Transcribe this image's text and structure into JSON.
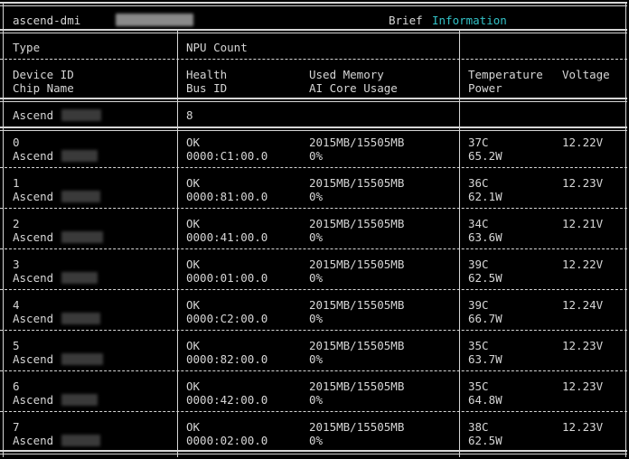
{
  "header": {
    "title": "ascend-dmi",
    "brief": "Brief",
    "information": "Information"
  },
  "summary_header": {
    "type": "Type",
    "npu_count": "NPU Count"
  },
  "column_header": {
    "device_id": "Device ID",
    "chip_name": "Chip Name",
    "health": "Health",
    "bus_id": "Bus ID",
    "used_memory": "Used Memory",
    "ai_core_usage": "AI Core Usage",
    "temperature": "Temperature",
    "power": "Power",
    "voltage": "Voltage"
  },
  "summary": {
    "type": "Ascend",
    "npu_count": "8"
  },
  "devices": [
    {
      "id": "0",
      "chip": "Ascend",
      "health": "OK",
      "bus": "0000:C1:00.0",
      "mem": "2015MB/15505MB",
      "core": "0%",
      "temp": "37C",
      "power": "65.2W",
      "volt": "12.22V"
    },
    {
      "id": "1",
      "chip": "Ascend",
      "health": "OK",
      "bus": "0000:81:00.0",
      "mem": "2015MB/15505MB",
      "core": "0%",
      "temp": "36C",
      "power": "62.1W",
      "volt": "12.23V"
    },
    {
      "id": "2",
      "chip": "Ascend",
      "health": "OK",
      "bus": "0000:41:00.0",
      "mem": "2015MB/15505MB",
      "core": "0%",
      "temp": "34C",
      "power": "63.6W",
      "volt": "12.21V"
    },
    {
      "id": "3",
      "chip": "Ascend",
      "health": "OK",
      "bus": "0000:01:00.0",
      "mem": "2015MB/15505MB",
      "core": "0%",
      "temp": "39C",
      "power": "62.5W",
      "volt": "12.22V"
    },
    {
      "id": "4",
      "chip": "Ascend",
      "health": "OK",
      "bus": "0000:C2:00.0",
      "mem": "2015MB/15505MB",
      "core": "0%",
      "temp": "39C",
      "power": "66.7W",
      "volt": "12.24V"
    },
    {
      "id": "5",
      "chip": "Ascend",
      "health": "OK",
      "bus": "0000:82:00.0",
      "mem": "2015MB/15505MB",
      "core": "0%",
      "temp": "35C",
      "power": "63.7W",
      "volt": "12.23V"
    },
    {
      "id": "6",
      "chip": "Ascend",
      "health": "OK",
      "bus": "0000:42:00.0",
      "mem": "2015MB/15505MB",
      "core": "0%",
      "temp": "35C",
      "power": "64.8W",
      "volt": "12.23V"
    },
    {
      "id": "7",
      "chip": "Ascend",
      "health": "OK",
      "bus": "0000:02:00.0",
      "mem": "2015MB/15505MB",
      "core": "0%",
      "temp": "38C",
      "power": "62.5W",
      "volt": "12.23V"
    }
  ]
}
